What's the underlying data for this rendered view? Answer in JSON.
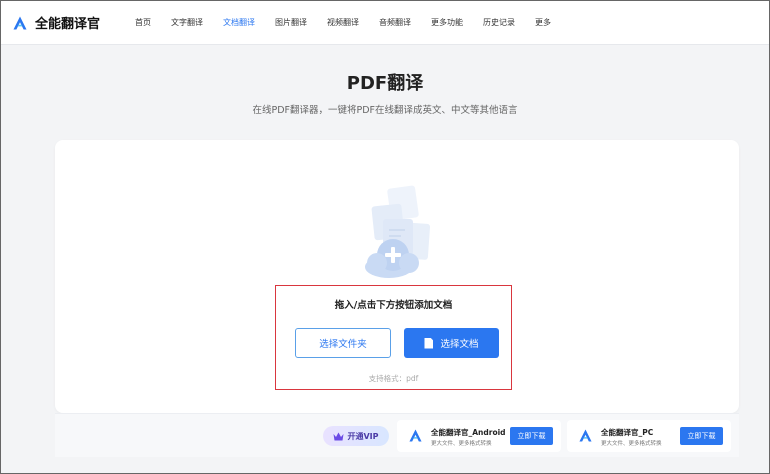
{
  "brand": {
    "name": "全能翻译官"
  },
  "nav": {
    "items": [
      {
        "label": "首页",
        "active": false
      },
      {
        "label": "文字翻译",
        "active": false
      },
      {
        "label": "文档翻译",
        "active": true
      },
      {
        "label": "图片翻译",
        "active": false
      },
      {
        "label": "视频翻译",
        "active": false
      },
      {
        "label": "音频翻译",
        "active": false
      },
      {
        "label": "更多功能",
        "active": false
      },
      {
        "label": "历史记录",
        "active": false
      },
      {
        "label": "更多",
        "active": false
      }
    ]
  },
  "hero": {
    "title": "PDF翻译",
    "subtitle": "在线PDF翻译器，一键将PDF在线翻译成英文、中文等其他语言"
  },
  "upload": {
    "prompt": "拖入/点击下方按钮添加文档",
    "folder_button": "选择文件夹",
    "document_button": "选择文档",
    "formats": "支持格式：pdf"
  },
  "footer": {
    "vip_label": "开通VIP",
    "apps": [
      {
        "name": "全能翻译官_Android",
        "desc": "更大文件、更多格式转换",
        "button": "立即下载"
      },
      {
        "name": "全能翻译官_PC",
        "desc": "更大文件、更多格式转换",
        "button": "立即下载"
      }
    ]
  },
  "colors": {
    "accent": "#2b77f0",
    "highlight_border": "#d9363e",
    "background": "#f3f4f6"
  }
}
